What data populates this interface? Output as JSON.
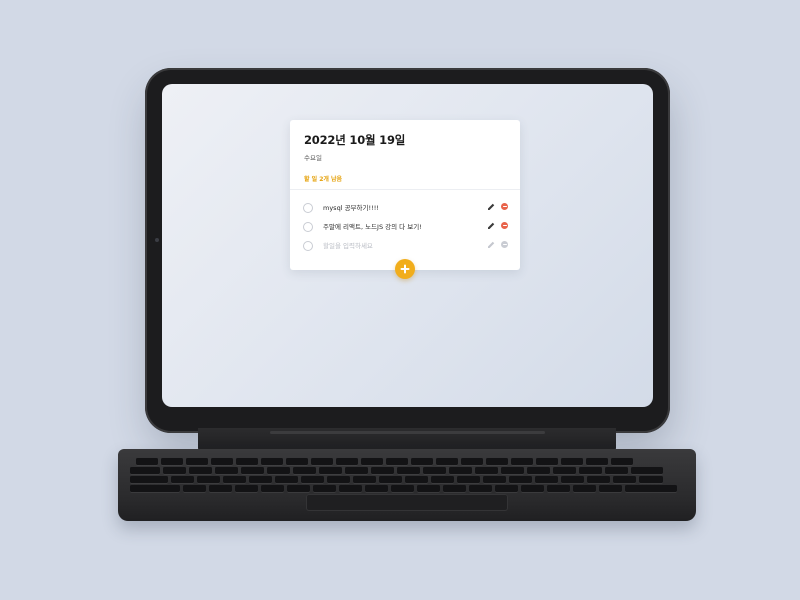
{
  "header": {
    "date": "2022년 10월 19일",
    "weekday": "수요일",
    "remaining": "할 일 2개 남음"
  },
  "todos": [
    {
      "text": "mysql 공부하기!!!!",
      "done": false
    },
    {
      "text": "주말에 리액트, 노드JS 강의 다 보기!",
      "done": false
    },
    {
      "text": "할일을 입력하세요",
      "done": false,
      "placeholder": true
    }
  ],
  "icons": {
    "edit": "pencil-icon",
    "delete": "minus-circle-icon",
    "add": "plus-icon"
  },
  "colors": {
    "accent": "#f1ad1b",
    "delete": "#e8634a",
    "remaining_text": "#e5a10a"
  }
}
